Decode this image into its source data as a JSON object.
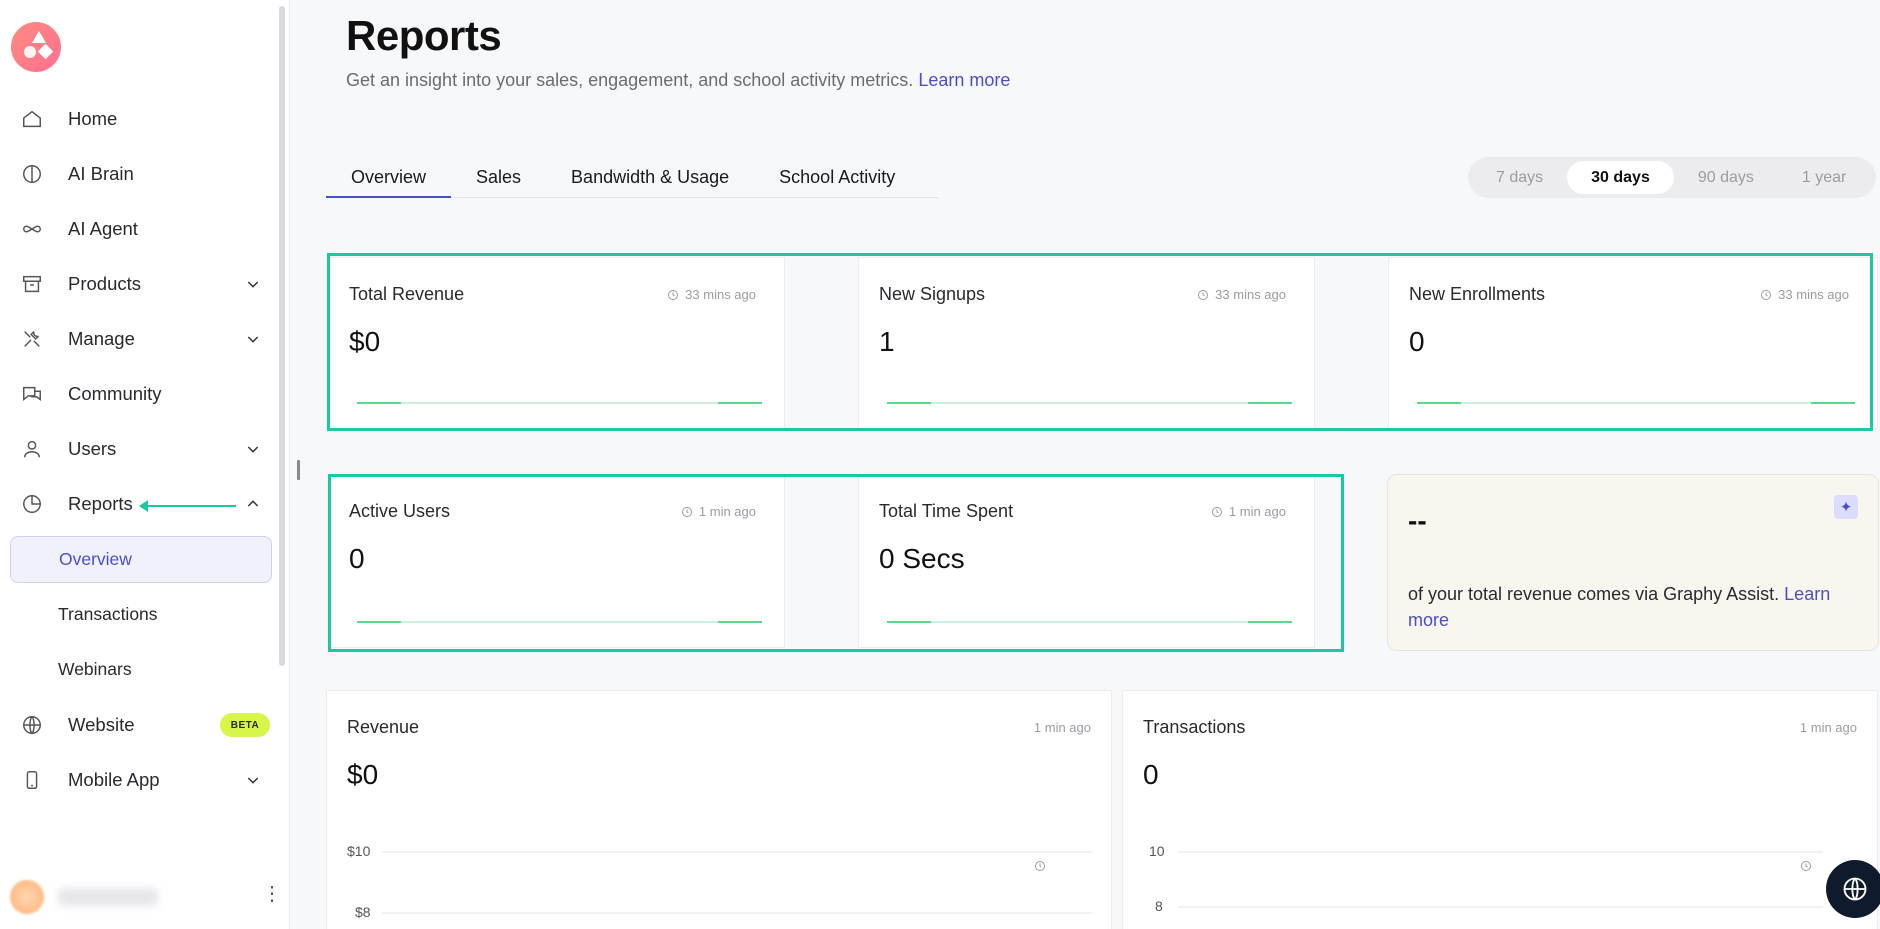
{
  "sidebar": {
    "logo_name": "school-logo",
    "items": [
      {
        "label": "Home",
        "icon": "home-icon",
        "chevron": false
      },
      {
        "label": "AI Brain",
        "icon": "brain-icon",
        "chevron": false
      },
      {
        "label": "AI Agent",
        "icon": "infinity-icon",
        "chevron": false
      },
      {
        "label": "Products",
        "icon": "archive-icon",
        "chevron": true
      },
      {
        "label": "Manage",
        "icon": "tools-icon",
        "chevron": true
      },
      {
        "label": "Community",
        "icon": "chat-icon",
        "chevron": false
      },
      {
        "label": "Users",
        "icon": "user-icon",
        "chevron": true
      },
      {
        "label": "Reports",
        "icon": "pie-chart-icon",
        "chevron": true,
        "expanded": true
      }
    ],
    "reports_sub": [
      {
        "label": "Overview",
        "active": true
      },
      {
        "label": "Transactions",
        "active": false
      },
      {
        "label": "Webinars",
        "active": false
      }
    ],
    "items_after": [
      {
        "label": "Website",
        "icon": "globe-icon",
        "badge": "BETA"
      },
      {
        "label": "Mobile App",
        "icon": "mobile-icon",
        "chevron": true
      }
    ]
  },
  "header": {
    "title": "Reports",
    "subtitle": "Get an insight into your sales, engagement, and school activity metrics.",
    "learn_more": "Learn more"
  },
  "tabs": [
    "Overview",
    "Sales",
    "Bandwidth & Usage",
    "School Activity"
  ],
  "active_tab": "Overview",
  "range": {
    "options": [
      "7 days",
      "30 days",
      "90 days",
      "1 year"
    ],
    "selected": "30 days"
  },
  "stats_row1": [
    {
      "title": "Total Revenue",
      "time": "33 mins ago",
      "value": "$0"
    },
    {
      "title": "New Signups",
      "time": "33 mins ago",
      "value": "1"
    },
    {
      "title": "New Enrollments",
      "time": "33 mins ago",
      "value": "0"
    }
  ],
  "stats_row2": [
    {
      "title": "Active Users",
      "time": "1 min ago",
      "value": "0"
    },
    {
      "title": "Total Time Spent",
      "time": "1 min ago",
      "value": "0 Secs"
    }
  ],
  "assist": {
    "value": "--",
    "text": "of your total revenue comes via Graphy Assist. Learn more",
    "link": "Learn more"
  },
  "charts": [
    {
      "title": "Revenue",
      "time": "1 min ago",
      "value": "$0",
      "ticks": [
        "$10",
        "$8"
      ]
    },
    {
      "title": "Transactions",
      "time": "1 min ago",
      "value": "0",
      "ticks": [
        "10",
        "8"
      ]
    }
  ],
  "colors": {
    "accent": "#4a4fc9",
    "highlight": "#1dc7a3",
    "beta": "#d8f54a"
  }
}
